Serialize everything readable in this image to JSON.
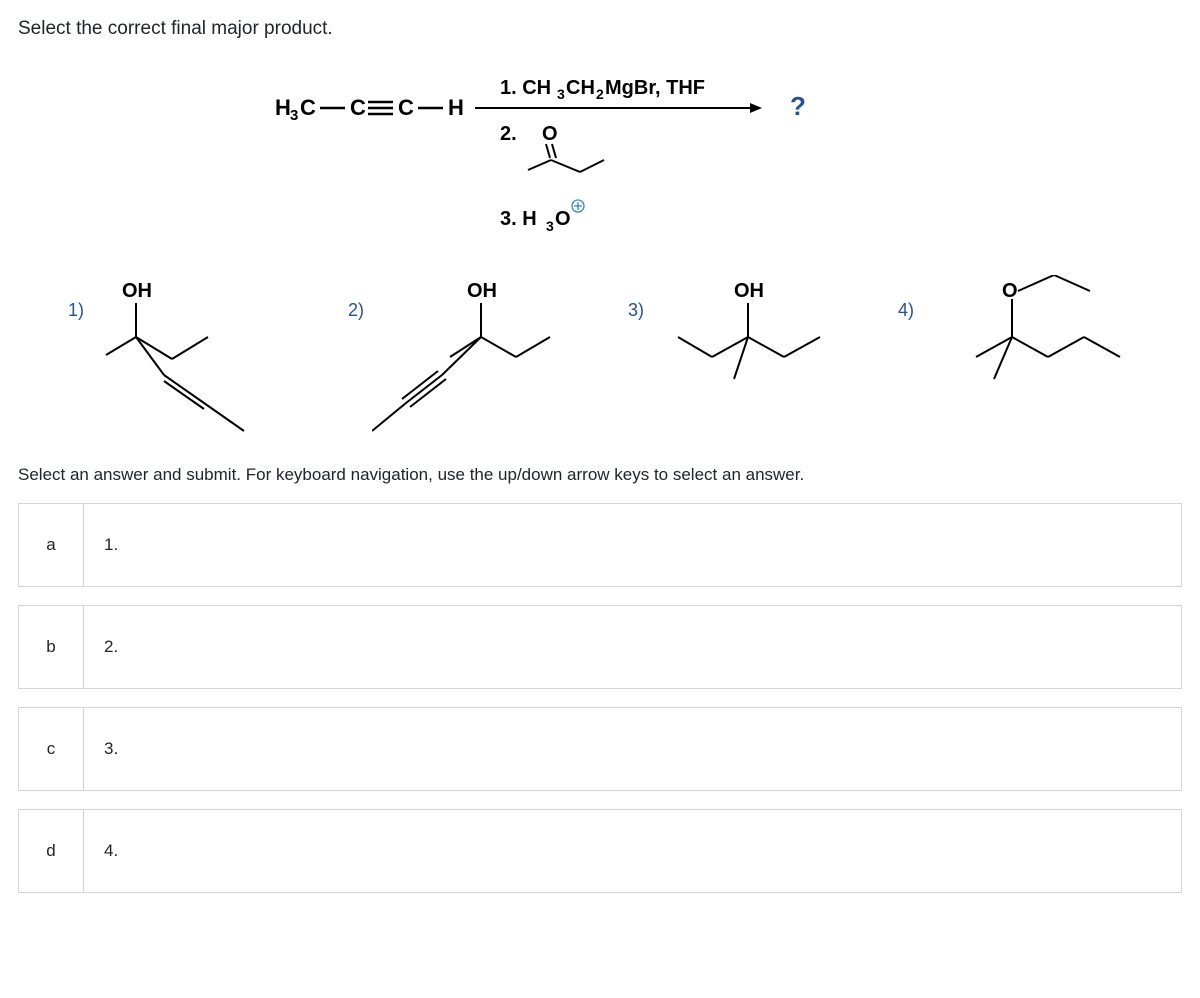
{
  "question": {
    "prompt": "Select the correct final major product.",
    "instructions": "Select an answer and submit. For keyboard navigation, use the up/down arrow keys to select an answer."
  },
  "scheme": {
    "startingMaterial": "H3C — C ≡ C — H",
    "reagent1": "1. CH3CH2MgBr, THF",
    "reagent2_label": "2.",
    "reagent2_compound": "O (butan-2-one)",
    "reagent3": "3. H3O",
    "reagent3_charge": "+",
    "productQ": "?"
  },
  "options": {
    "1": {
      "num": "1)",
      "label": "OH"
    },
    "2": {
      "num": "2)",
      "label": "OH"
    },
    "3": {
      "num": "3)",
      "label": "OH"
    },
    "4": {
      "num": "4)",
      "label": "O"
    }
  },
  "answers": {
    "a": {
      "key": "a",
      "value": "1."
    },
    "b": {
      "key": "b",
      "value": "2."
    },
    "c": {
      "key": "c",
      "value": "3."
    },
    "d": {
      "key": "d",
      "value": "4."
    }
  }
}
